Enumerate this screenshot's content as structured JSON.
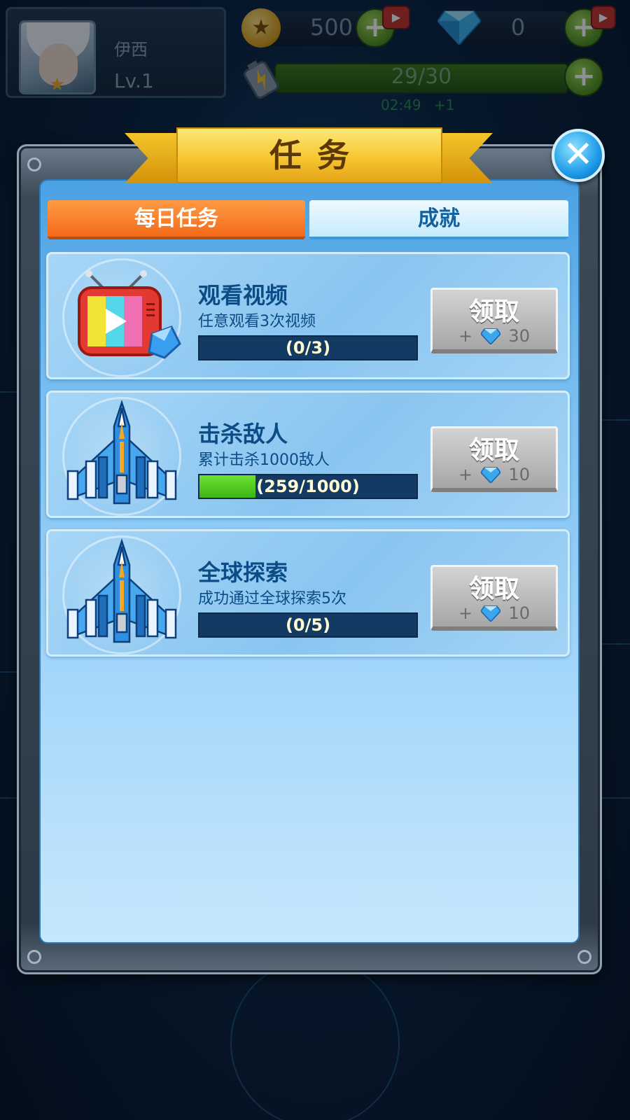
{
  "hud": {
    "player_name": "伊西",
    "player_level": "Lv.1",
    "coins": "500",
    "gems": "0",
    "energy": "29/30",
    "energy_timer": "02:49",
    "energy_regen": "+1"
  },
  "modal": {
    "title": "任务",
    "close_symbol": "✕",
    "tabs": [
      {
        "label": "每日任务",
        "active": true
      },
      {
        "label": "成就",
        "active": false
      }
    ]
  },
  "tasks": [
    {
      "title": "观看视频",
      "description": "任意观看3次视频",
      "progress_text": "(0/3)",
      "progress": 0,
      "claim_label": "领取",
      "reward_prefix": "+",
      "reward_amount": "30",
      "icon": "tv-video-icon"
    },
    {
      "title": "击杀敌人",
      "description": "累计击杀1000敌人",
      "progress_text": "(259/1000)",
      "progress": 0.259,
      "claim_label": "领取",
      "reward_prefix": "+",
      "reward_amount": "10",
      "icon": "fighter-jet-icon"
    },
    {
      "title": "全球探索",
      "description": "成功通过全球探索5次",
      "progress_text": "(0/5)",
      "progress": 0,
      "claim_label": "领取",
      "reward_prefix": "+",
      "reward_amount": "10",
      "icon": "fighter-jet-icon"
    }
  ],
  "colors": {
    "active_tab": "#f26a1a",
    "progress_fill": "#3cb414",
    "panel_text": "#0c4c86"
  }
}
